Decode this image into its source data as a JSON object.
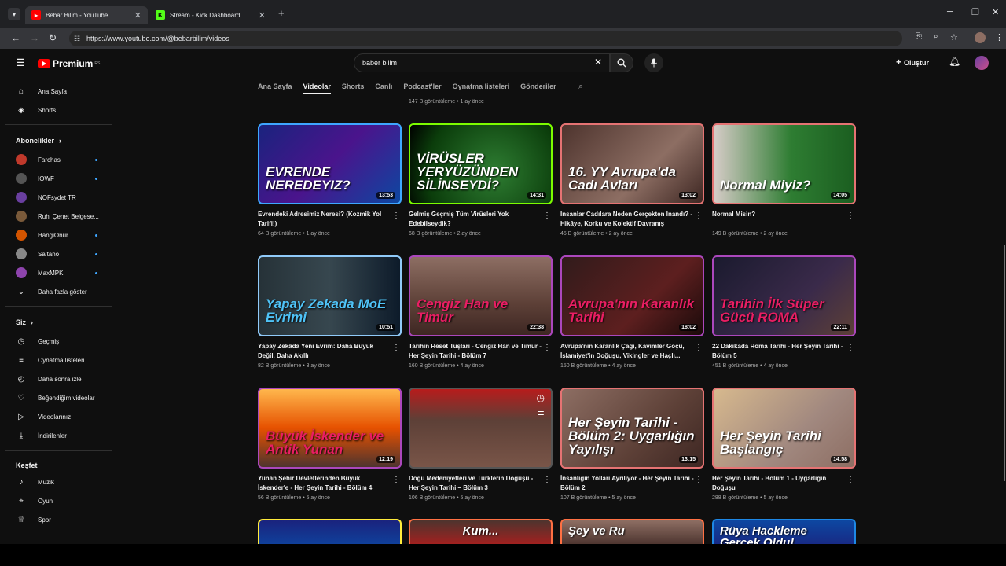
{
  "browser": {
    "tabs": [
      {
        "label": "Bebar Bilim - YouTube",
        "icon": "youtube-icon"
      },
      {
        "label": "Stream - Kick Dashboard",
        "icon": "kick-icon"
      }
    ],
    "url": "https://www.youtube.com/@bebarbilim/videos"
  },
  "header": {
    "logo": "Premium",
    "logo_region": "RS",
    "search_value": "baber bilim",
    "create_label": "Oluştur"
  },
  "sidebar": {
    "home": "Ana Sayfa",
    "shorts": "Shorts",
    "subs_title": "Abonelikler",
    "subs": [
      {
        "label": "Farchas",
        "color": "#c0392b",
        "dot": true
      },
      {
        "label": "IOWF",
        "color": "#555555",
        "dot": true
      },
      {
        "label": "NOFsydet TR",
        "color": "#6a3fa0",
        "dot": false
      },
      {
        "label": "Ruhi Çenet Belgese...",
        "color": "#7a5a3a",
        "dot": false
      },
      {
        "label": "HangiOnur",
        "color": "#d35400",
        "dot": true
      },
      {
        "label": "Saltano",
        "color": "#888888",
        "dot": true
      },
      {
        "label": "MaxMPK",
        "color": "#8e44ad",
        "dot": true
      }
    ],
    "more": "Daha fazla göster",
    "you_title": "Siz",
    "you": [
      "Geçmiş",
      "Oynatma listeleri",
      "Daha sonra izle",
      "Beğendiğim videolar",
      "Videolarınız",
      "İndirilenler"
    ],
    "explore_title": "Keşfet",
    "explore": [
      "Müzik",
      "Oyun",
      "Spor"
    ]
  },
  "channel_tabs": [
    "Ana Sayfa",
    "Videolar",
    "Shorts",
    "Canlı",
    "Podcast'ler",
    "Oynatma listeleri",
    "Gönderiler"
  ],
  "top_meta": "147 B görüntüleme • 1 ay önce",
  "videos": [
    {
      "thumb": "EVRENDE NEREDEYIZ?",
      "dur": "13:53",
      "title": "Evrendeki Adresimiz Neresi? (Kozmik Yol Tarifi!)",
      "meta": "64 B görüntüleme • 1 ay önce",
      "border": "#3ea6ff",
      "bg": "linear-gradient(135deg,#1a237e,#4a148c 50%,#0d47a1)",
      "tc": "#ffffff"
    },
    {
      "thumb": "VİRÜSLER YERYÜZÜNDEN SİLİNSEYDİ?",
      "dur": "14:31",
      "title": "Gelmiş Geçmiş Tüm Virüsleri Yok Edebilseydik?",
      "meta": "68 B görüntüleme • 2 ay önce",
      "border": "#7cfc00",
      "bg": "radial-gradient(circle at 60% 60%,#2e7d32,#0b3d0b 70%,#000)",
      "tc": "#ffffff"
    },
    {
      "thumb": "16. YY Avrupa'da Cadı Avları",
      "dur": "13:02",
      "title": "İnsanlar Cadılara Neden Gerçekten İnandı? - Hikâye, Korku ve Kolektif Davranış",
      "meta": "45 B görüntüleme • 2 ay önce",
      "border": "#e57373",
      "bg": "linear-gradient(135deg,#4e342e,#8d6e63 60%,#3e2723)",
      "tc": "#ffffff"
    },
    {
      "thumb": "Normal Miyiz?",
      "dur": "14:05",
      "title": "Normal Misin?",
      "meta": "149 B görüntüleme • 2 ay önce",
      "border": "#e57373",
      "bg": "linear-gradient(90deg,#d7ccc8,#2e7d32 55%,#1b5e20)",
      "tc": "#ffffff"
    },
    {
      "thumb": "Yapay Zekada MoE Evrimi",
      "dur": "10:51",
      "title": "Yapay Zekâda Yeni Evrim: Daha Büyük Değil, Daha Akıllı",
      "meta": "82 B görüntüleme • 3 ay önce",
      "border": "#90caf9",
      "bg": "linear-gradient(90deg,#263238,#37474f 50%,#0d1b2a)",
      "tc": "#4fc3f7"
    },
    {
      "thumb": "Cengiz Han ve Timur",
      "dur": "22:38",
      "title": "Tarihin Reset Tuşları - Cengiz Han ve Timur - Her Şeyin Tarihi - Bölüm 7",
      "meta": "160 B görüntüleme • 4 ay önce",
      "border": "#ab47bc",
      "bg": "linear-gradient(180deg,#8d6e63,#5d4037 60%,#3e2723)",
      "tc": "#e91e63"
    },
    {
      "thumb": "Avrupa'nın Karanlık Tarihi",
      "dur": "18:02",
      "title": "Avrupa'nın Karanlık Çağı, Kavimler Göçü, İslamiyet'in Doğuşu, Vikingler ve Haçlı...",
      "meta": "150 B görüntüleme • 4 ay önce",
      "border": "#ab47bc",
      "bg": "linear-gradient(135deg,#311b1b,#5d1f1f 60%,#1a0a0a)",
      "tc": "#e91e63"
    },
    {
      "thumb": "Tarihin İlk Süper Gücü ROMA",
      "dur": "22:11",
      "title": "22 Dakikada Roma Tarihi - Her Şeyin Tarihi - Bölüm 5",
      "meta": "451 B görüntüleme • 4 ay önce",
      "border": "#ab47bc",
      "bg": "linear-gradient(135deg,#1a1a2e,#3a2a4a 60%,#5d4037)",
      "tc": "#e91e63"
    },
    {
      "thumb": "Büyük İskender ve Antik Yunan",
      "dur": "12:19",
      "title": "Yunan Şehir Devletlerinden Büyük İskender'e - Her Şeyin Tarihi - Bölüm 4",
      "meta": "56 B görüntüleme • 5 ay önce",
      "border": "#ab47bc",
      "bg": "linear-gradient(180deg,#ffb74d,#e65100 50%,#4e342e)",
      "tc": "#e91e63"
    },
    {
      "thumb": "",
      "dur": "",
      "title": "Doğu Medeniyetleri ve Türklerin Doğuşu - Her Şeyin Tarihi – Bölüm 3",
      "meta": "106 B görüntüleme • 5 ay önce",
      "border": "#555555",
      "bg": "linear-gradient(180deg,#b71c1c,#5d4037 40%,#795548)",
      "tc": "#ffffff"
    },
    {
      "thumb": "Her Şeyin Tarihi - Bölüm 2: Uygarlığın Yayılışı",
      "dur": "13:15",
      "title": "İnsanlığın Yolları Ayrılıyor - Her Şeyin Tarihi - Bölüm 2",
      "meta": "107 B görüntüleme • 5 ay önce",
      "border": "#e57373",
      "bg": "linear-gradient(135deg,#8d6e63,#5d4037 60%,#3e2723)",
      "tc": "#ffffff"
    },
    {
      "thumb": "Her Şeyin Tarihi Başlangıç",
      "dur": "14:58",
      "title": "Her Şeyin Tarihi - Bölüm 1 - Uygarlığın Doğuşu",
      "meta": "288 B görüntüleme • 5 ay önce",
      "border": "#e57373",
      "bg": "linear-gradient(135deg,#d7b98e,#a1887f 60%,#8d6e63)",
      "tc": "#ffffff"
    }
  ],
  "partial_row": [
    {
      "thumb": "",
      "border": "#ffeb3b",
      "bg": "linear-gradient(180deg,#1a237e,#0d47a1)"
    },
    {
      "thumb": "Kum...",
      "border": "#ff7043",
      "bg": "linear-gradient(180deg,#4e342e,#b71c1c)"
    },
    {
      "thumb": "Şey ve Ru",
      "border": "#ff7043",
      "bg": "linear-gradient(180deg,#8d6e63,#3e2723)"
    },
    {
      "thumb": "Rüya Hackleme Gerçek Oldu!",
      "border": "#1e88e5",
      "bg": "linear-gradient(180deg,#0d47a1,#1a237e)"
    }
  ]
}
